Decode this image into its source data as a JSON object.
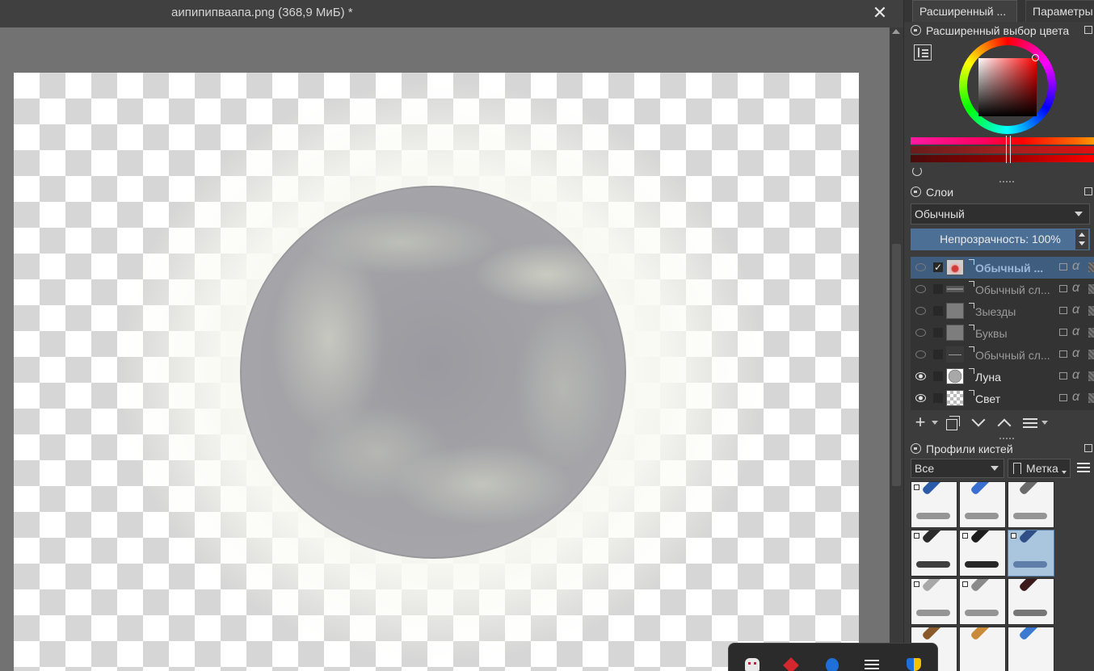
{
  "document": {
    "title": "аипипипваапа.png (368,9 МиБ) *",
    "close_glyph": "✕"
  },
  "docker": {
    "tabs": [
      {
        "label": "Расширенный ..."
      },
      {
        "label": "Параметры"
      }
    ],
    "color_selector": {
      "title": "Расширенный выбор цвета",
      "current_color": "#ff0000"
    },
    "layers": {
      "title": "Слои",
      "blend_mode": "Обычный",
      "opacity_text": "Непрозрачность:  100%",
      "items": [
        {
          "name": "Обычный ...",
          "visible": false,
          "selected": true,
          "checked": "✓"
        },
        {
          "name": "Обычный сл...",
          "visible": false,
          "selected": false,
          "checked": ""
        },
        {
          "name": "Зыезды",
          "visible": false,
          "selected": false,
          "checked": ""
        },
        {
          "name": "Буквы",
          "visible": false,
          "selected": false,
          "checked": ""
        },
        {
          "name": "Обычный сл...",
          "visible": false,
          "selected": false,
          "checked": ""
        },
        {
          "name": "Луна",
          "visible": true,
          "selected": false,
          "checked": ""
        },
        {
          "name": "Свет",
          "visible": true,
          "selected": false,
          "checked": ""
        }
      ],
      "alpha_glyph": "α",
      "toolbar_add_glyph": "+"
    },
    "brushes": {
      "title": "Профили кистей",
      "filter": "Все",
      "tag_label": "Метка",
      "presets": [
        {
          "icon": "eraser-brush-icon",
          "color": "#2b5aa8",
          "selected": false
        },
        {
          "icon": "blue-pen-brush-icon",
          "color": "#3a6fd0",
          "selected": false
        },
        {
          "icon": "smudge-brush-icon",
          "color": "#6a6a6a",
          "selected": false
        },
        {
          "icon": "ink-pen-brush-icon",
          "color": "#2a2a2a",
          "selected": false
        },
        {
          "icon": "marker-brush-icon",
          "color": "#1d1d1d",
          "selected": false
        },
        {
          "icon": "blue-fineliner-brush-icon",
          "color": "#2f4f86",
          "selected": true
        },
        {
          "icon": "pencil-brush-icon",
          "color": "#c8c8c8",
          "selected": false
        },
        {
          "icon": "gray-pencil-brush-icon",
          "color": "#b0b0b0",
          "selected": false
        },
        {
          "icon": "dip-pen-brush-icon",
          "color": "#3a1a1a",
          "selected": false
        },
        {
          "icon": "brown-pencil-brush-icon",
          "color": "#8a5a2a",
          "selected": false
        },
        {
          "icon": "wood-brush-icon",
          "color": "#c98a3a",
          "selected": false
        },
        {
          "icon": "blue-brush-icon",
          "color": "#3b7ad0",
          "selected": false
        }
      ]
    }
  },
  "taskbar_popup": {
    "icons": [
      "bot-icon",
      "red-app-icon",
      "bluetooth-icon",
      "menu-icon",
      "shield-icon"
    ]
  }
}
